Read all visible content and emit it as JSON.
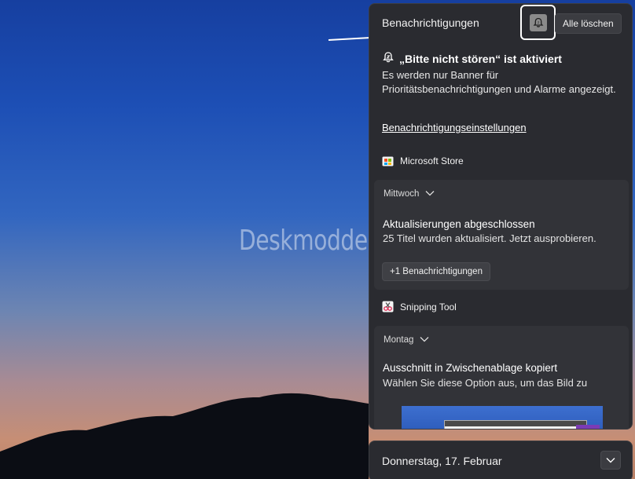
{
  "watermark": "Deskmodder.de",
  "panel": {
    "title": "Benachrichtigungen",
    "clear_all_label": "Alle löschen",
    "dnd": {
      "title": "„Bitte nicht stören“ ist aktiviert",
      "description": "Es werden nur Banner für Prioritätsbenachrichtigungen und Alarme angezeigt.",
      "settings_link": "Benachrichtigungseinstellungen"
    },
    "groups": [
      {
        "app": "Microsoft Store",
        "icon": "microsoft-store-icon",
        "day": "Mittwoch",
        "title": "Aktualisierungen abgeschlossen",
        "text": "25 Titel wurden aktualisiert. Jetzt ausprobieren.",
        "more_label": "+1 Benachrichtigungen"
      },
      {
        "app": "Snipping Tool",
        "icon": "snipping-tool-icon",
        "day": "Montag",
        "title": "Ausschnitt in Zwischenablage kopiert",
        "text": "Wählen Sie diese Option aus, um das Bild zu"
      }
    ]
  },
  "calendar": {
    "date": "Donnerstag, 17. Februar"
  },
  "colors": {
    "panel_bg": "#2a2b30",
    "card_bg": "#323338",
    "text": "#ffffff"
  }
}
